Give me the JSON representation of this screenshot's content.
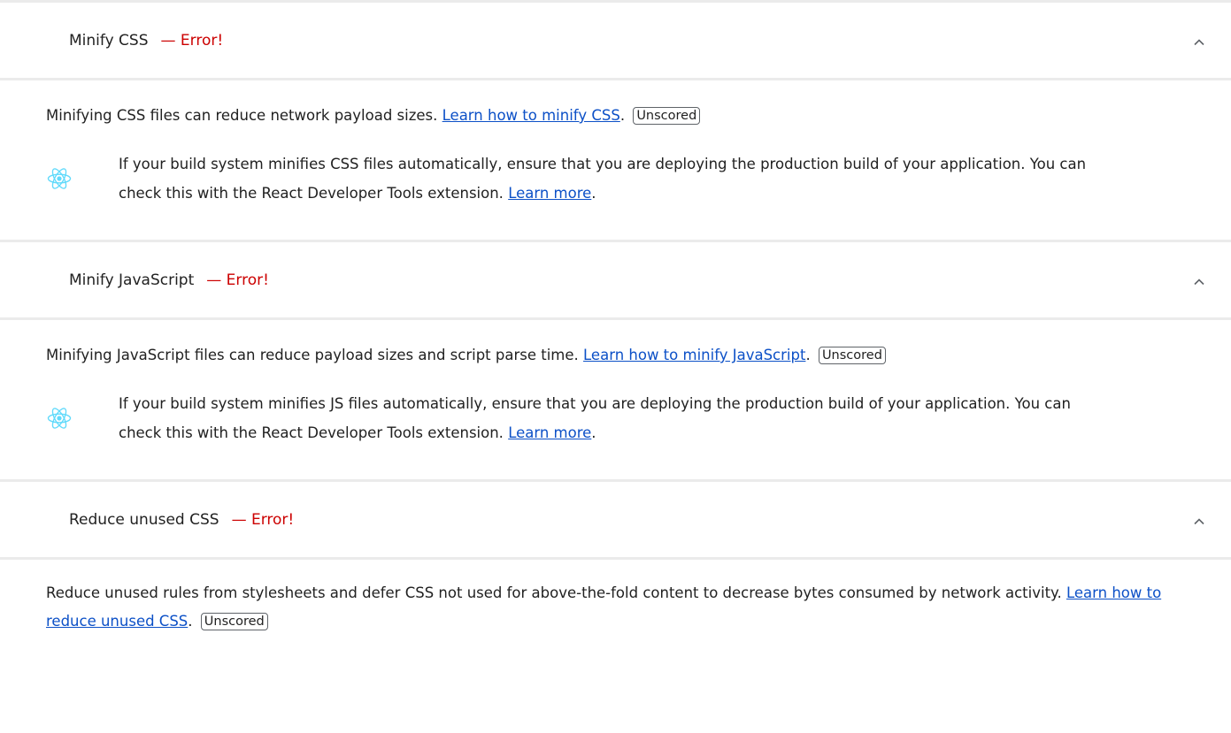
{
  "audits": [
    {
      "title": "Minify CSS",
      "status": "— Error!",
      "description": "Minifying CSS files can reduce network payload sizes. ",
      "link_text": "Learn how to minify CSS",
      "badge": "Unscored",
      "stack_pack": {
        "icon": "react-icon",
        "text": "If your build system minifies CSS files automatically, ensure that you are deploying the production build of your application. You can check this with the React Developer Tools extension. ",
        "link_text": "Learn more"
      }
    },
    {
      "title": "Minify JavaScript",
      "status": "— Error!",
      "description": "Minifying JavaScript files can reduce payload sizes and script parse time. ",
      "link_text": "Learn how to minify JavaScript",
      "badge": "Unscored",
      "stack_pack": {
        "icon": "react-icon",
        "text": "If your build system minifies JS files automatically, ensure that you are deploying the production build of your application. You can check this with the React Developer Tools extension. ",
        "link_text": "Learn more"
      }
    },
    {
      "title": "Reduce unused CSS",
      "status": "— Error!",
      "description": "Reduce unused rules from stylesheets and defer CSS not used for above-the-fold content to decrease bytes consumed by network activity. ",
      "link_text": "Learn how to reduce unused CSS",
      "badge": "Unscored"
    }
  ],
  "punctuation": ".",
  "colors": {
    "error": "#cc0000",
    "link": "#0c50c7",
    "react": "#61dafb",
    "divider": "#ebebeb"
  },
  "icons": {
    "chevron": "chevron-up-icon",
    "stack": "react-icon"
  }
}
